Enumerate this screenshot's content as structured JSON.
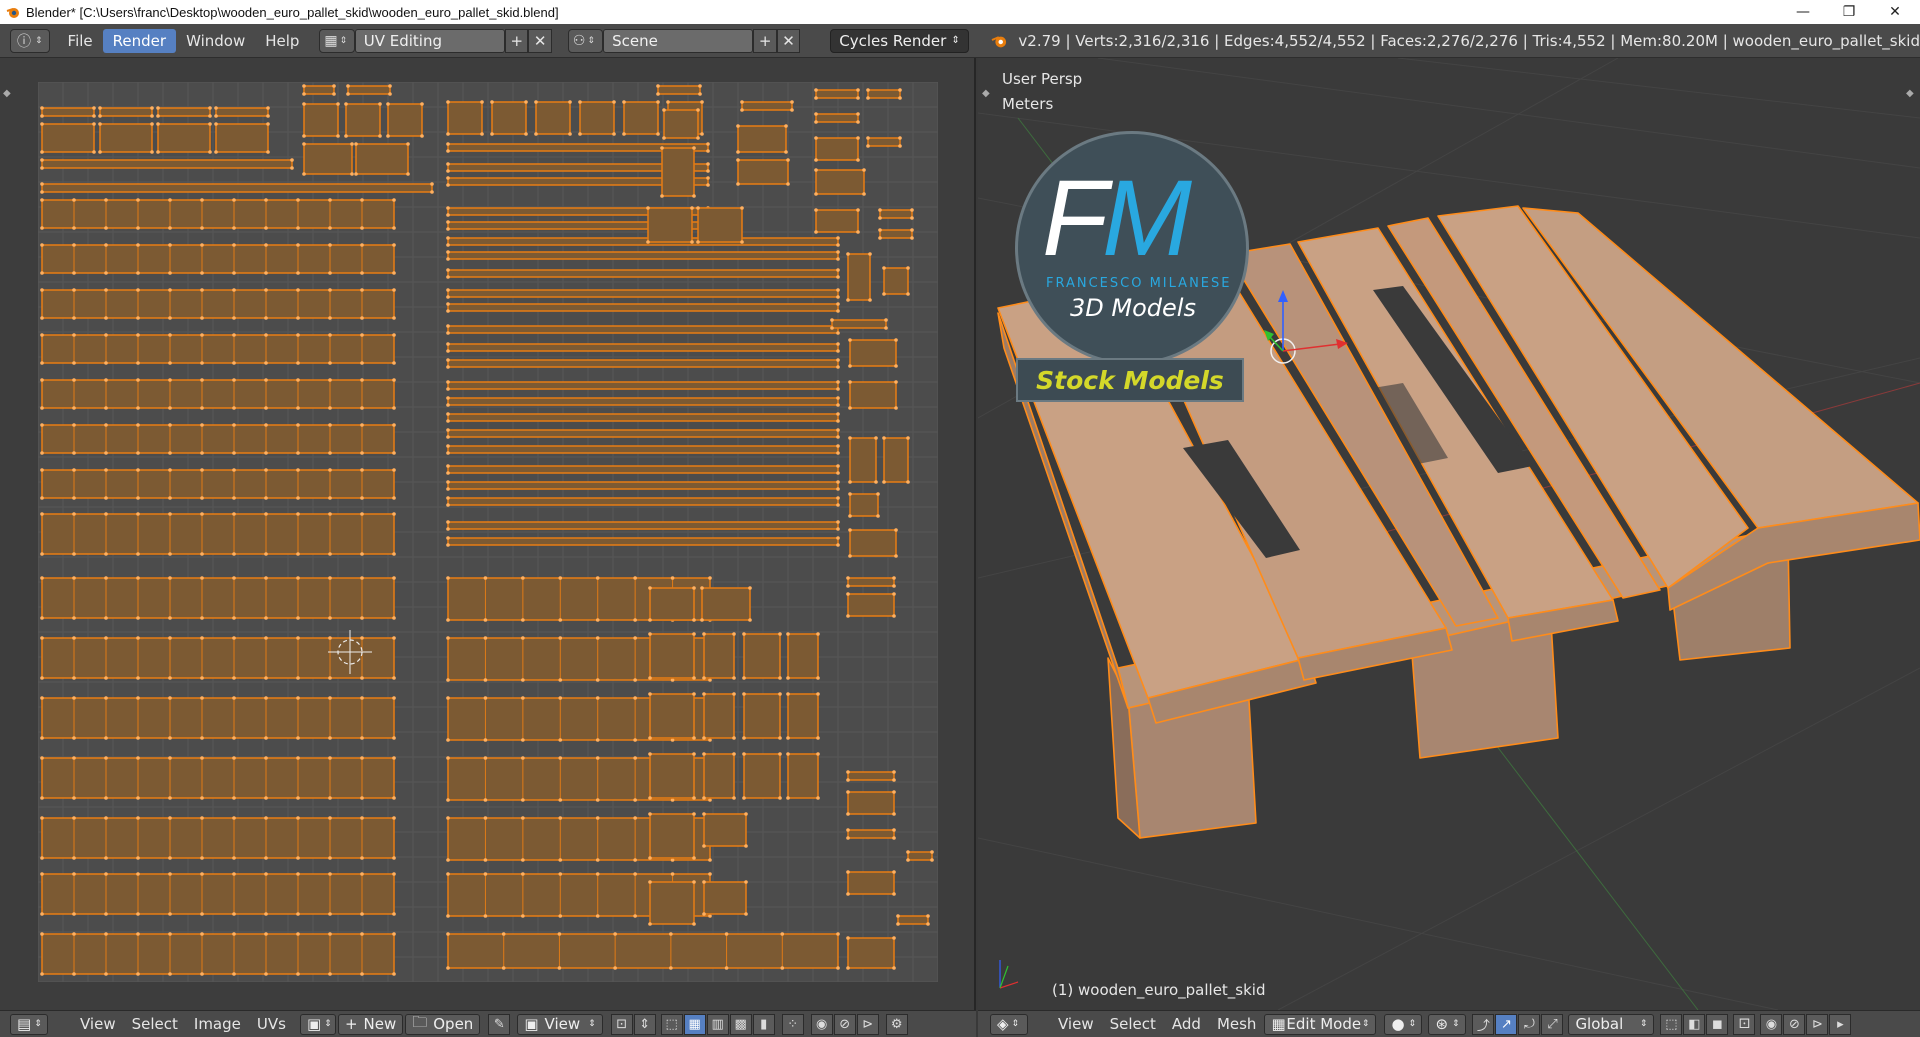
{
  "window": {
    "title": "Blender* [C:\\Users\\franc\\Desktop\\wooden_euro_pallet_skid\\wooden_euro_pallet_skid.blend]",
    "minimize": "—",
    "maximize": "❐",
    "close": "✕"
  },
  "infobar": {
    "menus": [
      "File",
      "Render",
      "Window",
      "Help"
    ],
    "active_menu": "Render",
    "screen_layout": "UV Editing",
    "scene": "Scene",
    "render_engine": "Cycles Render",
    "stats": "v2.79 | Verts:2,316/2,316 | Edges:4,552/4,552 | Faces:2,276/2,276 | Tris:4,552 | Mem:80.20M | wooden_euro_pallet_skid",
    "add_icon": "+",
    "remove_icon": "✕"
  },
  "viewport": {
    "view_name": "User Persp",
    "units": "Meters",
    "object_label": "(1) wooden_euro_pallet_skid",
    "logo": {
      "letters_f": "F",
      "letters_m": "M",
      "name": "FRANCESCO MILANESE",
      "sub": "3D Models",
      "banner": "Stock Models"
    }
  },
  "uv_footer": {
    "menus": [
      "View",
      "Select",
      "Image",
      "UVs"
    ],
    "new_label": "New",
    "open_label": "Open",
    "view_dd": "View"
  },
  "vp_footer": {
    "menus": [
      "View",
      "Select",
      "Add",
      "Mesh"
    ],
    "mode": "Edit Mode",
    "orientation": "Global"
  },
  "colors": {
    "uv_edge": "#e07a16",
    "uv_face": "#7c5a33",
    "wood": "#c79e82",
    "selection": "#ff8c1a",
    "accent": "#5680c2"
  }
}
